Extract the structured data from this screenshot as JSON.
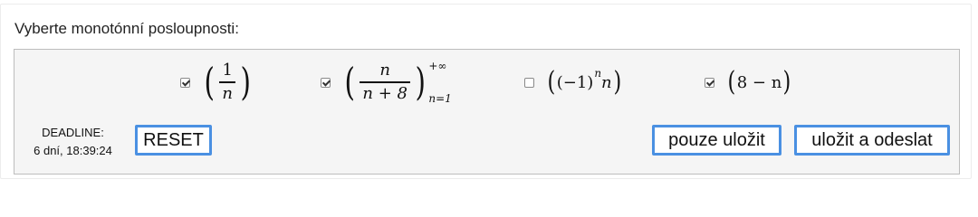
{
  "question": {
    "prompt": "Vyberte monotónní posloupnosti:"
  },
  "options": [
    {
      "id": "opt1",
      "checked": true,
      "numerator": "1",
      "denominator": "n"
    },
    {
      "id": "opt2",
      "checked": true,
      "numerator": "n",
      "denominator": "n + 8",
      "sup": "+∞",
      "sub": "n=1"
    },
    {
      "id": "opt3",
      "checked": false,
      "base": "(−1)",
      "exponent": "n",
      "tail": "n"
    },
    {
      "id": "opt4",
      "checked": true,
      "expression": "8 − n"
    }
  ],
  "deadline": {
    "label": "DEADLINE:",
    "remaining": "6 dní, 18:39:24"
  },
  "buttons": {
    "reset": "RESET",
    "save": "pouze uložit",
    "save_submit": "uložit a odeslat"
  }
}
